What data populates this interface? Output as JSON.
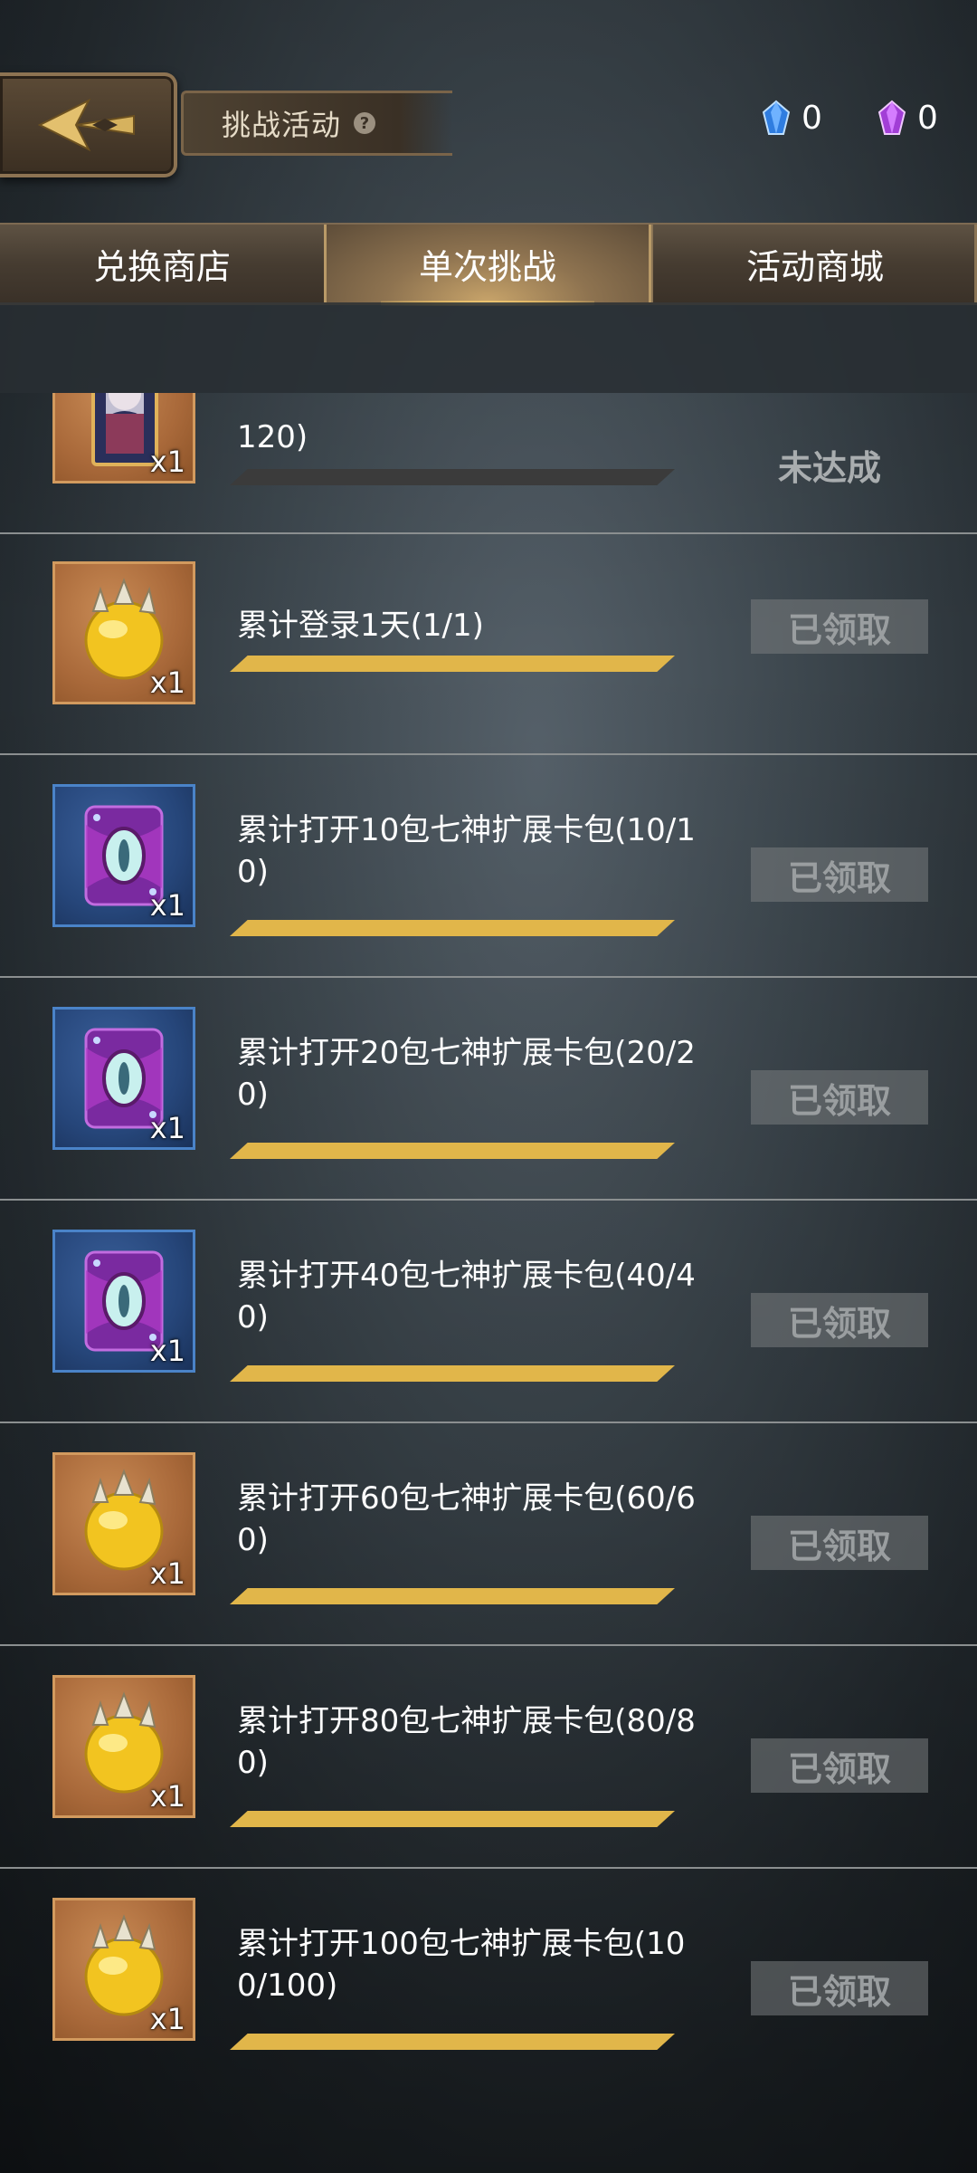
{
  "header": {
    "title": "挑战活动",
    "help_icon": "?",
    "currencies": [
      {
        "icon": "blue-crystal-icon",
        "value": "0"
      },
      {
        "icon": "purple-crystal-icon",
        "value": "0"
      }
    ]
  },
  "tabs": [
    {
      "label": "兑换商店",
      "active": false
    },
    {
      "label": "单次挑战",
      "active": true
    },
    {
      "label": "活动商城",
      "active": false
    }
  ],
  "tasks": [
    {
      "reward_icon": "character-card-icon",
      "qty": "x1",
      "label": "120)",
      "progress": 0,
      "status": "未达成"
    },
    {
      "reward_icon": "gold-orb-icon",
      "qty": "x1",
      "label": "累计登录1天(1/1)",
      "progress": 1,
      "status": "已领取"
    },
    {
      "reward_icon": "purple-card-pack-icon",
      "qty": "x1",
      "label": "累计打开10包七神扩展卡包(10/10)",
      "progress": 1,
      "status": "已领取"
    },
    {
      "reward_icon": "purple-card-pack-icon",
      "qty": "x1",
      "label": "累计打开20包七神扩展卡包(20/20)",
      "progress": 1,
      "status": "已领取"
    },
    {
      "reward_icon": "purple-card-pack-icon",
      "qty": "x1",
      "label": "累计打开40包七神扩展卡包(40/40)",
      "progress": 1,
      "status": "已领取"
    },
    {
      "reward_icon": "gold-orb-icon",
      "qty": "x1",
      "label": "累计打开60包七神扩展卡包(60/60)",
      "progress": 1,
      "status": "已领取"
    },
    {
      "reward_icon": "gold-orb-icon",
      "qty": "x1",
      "label": "累计打开80包七神扩展卡包(80/80)",
      "progress": 1,
      "status": "已领取"
    },
    {
      "reward_icon": "gold-orb-icon",
      "qty": "x1",
      "label": "累计打开100包七神扩展卡包(100/100)",
      "progress": 1,
      "status": "已领取"
    }
  ],
  "colors": {
    "progress_fill": "#e1b64a",
    "accent_gold": "#b99a68"
  }
}
